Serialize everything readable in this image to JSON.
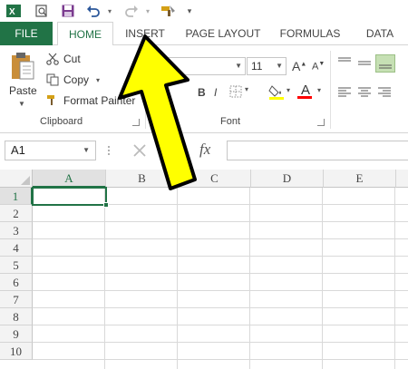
{
  "quick_access": {
    "excel_icon": "excel-logo-icon",
    "items": [
      "search-icon",
      "save-icon",
      "undo-icon",
      "redo-icon",
      "format-painter-icon",
      "customize-icon"
    ]
  },
  "tabs": {
    "file": "FILE",
    "home": "HOME",
    "insert": "INSERT",
    "page_layout": "PAGE LAYOUT",
    "formulas": "FORMULAS",
    "data": "DATA"
  },
  "clipboard": {
    "paste": "Paste",
    "cut": "Cut",
    "copy": "Copy",
    "format_painter": "Format Painter",
    "group_label": "Clipboard"
  },
  "font": {
    "font_name": "gia",
    "font_size": "11",
    "group_label": "Font",
    "grow": "A",
    "shrink": "A",
    "bold": "B",
    "italic": "I",
    "underline": "U",
    "font_color_letter": "A",
    "fill_color": "#ffff00",
    "font_color": "#ff0000"
  },
  "formula_bar": {
    "name_box": "A1",
    "fx": "fx",
    "value": ""
  },
  "grid": {
    "columns": [
      "A",
      "B",
      "C",
      "D",
      "E"
    ],
    "rows": [
      "1",
      "2",
      "3",
      "4",
      "5",
      "6",
      "7",
      "8",
      "9",
      "10"
    ],
    "active_cell": "A1"
  },
  "colors": {
    "accent": "#217346",
    "arrow_fill": "#ffff00",
    "arrow_stroke": "#000000"
  }
}
